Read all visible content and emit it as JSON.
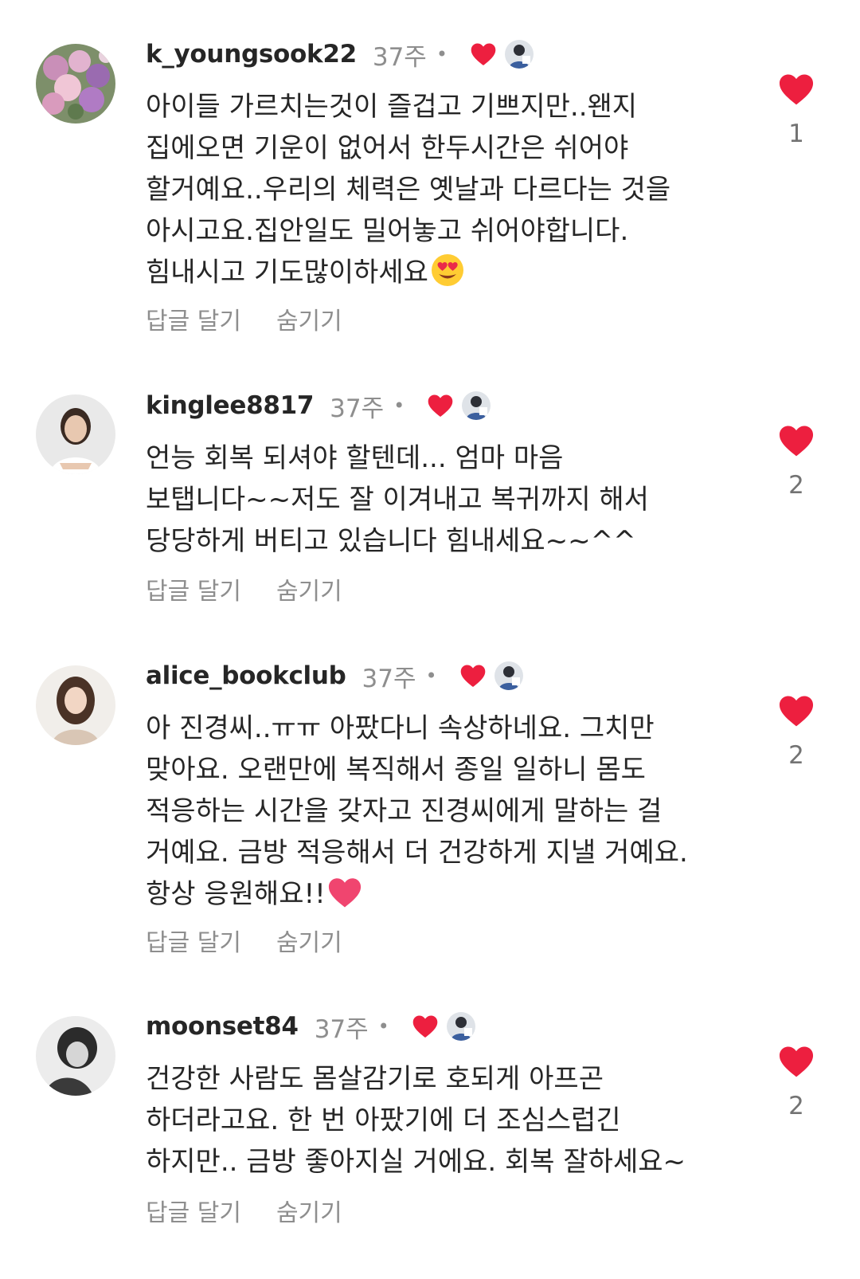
{
  "colors": {
    "heart": "#ed1f3f",
    "muted": "#8e8e8e",
    "text": "#262626"
  },
  "actions": {
    "reply_label": "답글 달기",
    "hide_label": "숨기기"
  },
  "comments": [
    {
      "username": "k_youngsook22",
      "time": "37주",
      "dot": "•",
      "lines": [
        "아이들 가르치는것이 즐겁고 기쁘지만..왠지",
        "집에오면 기운이 없어서 한두시간은 쉬어야",
        "할거예요..우리의 체력은 옛날과 다르다는 것을",
        "아시고요.집안일도 밀어놓고  쉬어야합니다.",
        "힘내시고  기도많이하세요"
      ],
      "emoji": "heart-eyes-emoji",
      "likes": "1"
    },
    {
      "username": "kinglee8817",
      "time": "37주",
      "dot": "•",
      "lines": [
        "언능 회복 되셔야 할텐데... 엄마 마음",
        "보탭니다~~저도 잘 이겨내고 복귀까지 해서",
        "당당하게 버티고 있습니다  힘내세요~~^^"
      ],
      "likes": "2"
    },
    {
      "username": "alice_bookclub",
      "time": "37주",
      "dot": "•",
      "lines": [
        "아 진경씨..ㅠㅠ 아팠다니 속상하네요. 그치만",
        "맞아요. 오랜만에 복직해서 종일 일하니 몸도",
        "적응하는 시간을 갖자고 진경씨에게 말하는 걸",
        "거예요. 금방 적응해서 더 건강하게 지낼 거예요.",
        "항상 응원해요!!"
      ],
      "emoji": "pink-heart-emoji",
      "likes": "2"
    },
    {
      "username": "moonset84",
      "time": "37주",
      "dot": "•",
      "lines": [
        "건강한 사람도 몸살감기로 호되게 아프곤",
        "하더라고요. 한 번 아팠기에 더 조심스럽긴",
        "하지만.. 금방 좋아지실 거에요. 회복 잘하세요~"
      ],
      "likes": "2"
    }
  ]
}
